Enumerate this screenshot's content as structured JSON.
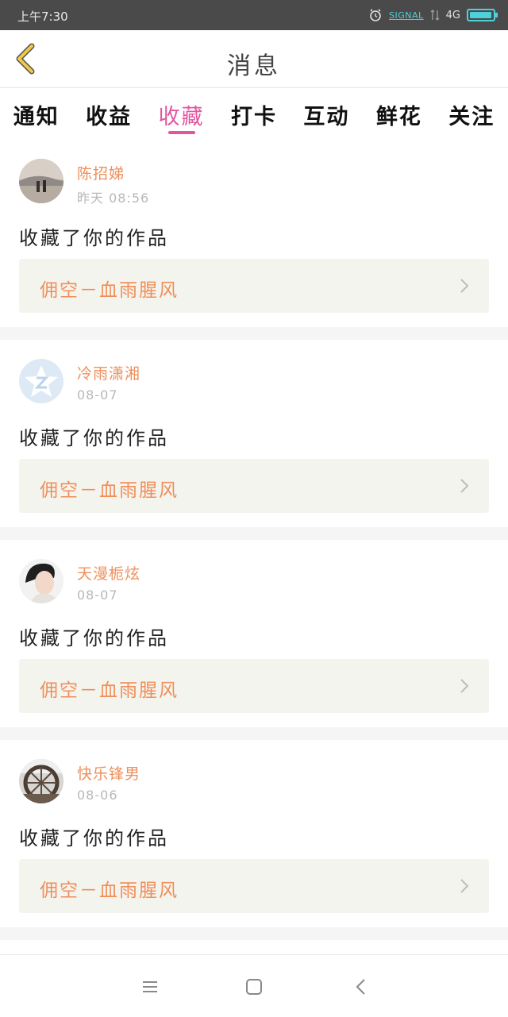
{
  "status_bar": {
    "time": "上午7:30",
    "signal_label": "SIGNAL",
    "network": "4G",
    "battery_level": 0.95,
    "icons": [
      "alarm-icon",
      "data-arrows-icon",
      "battery-icon"
    ]
  },
  "header": {
    "title": "消息",
    "back_icon": "chevron-left-icon",
    "accent_color": "#f0c94a"
  },
  "tabs": {
    "items": [
      {
        "label": "通知",
        "active": false
      },
      {
        "label": "收益",
        "active": false
      },
      {
        "label": "收藏",
        "active": true
      },
      {
        "label": "打卡",
        "active": false
      },
      {
        "label": "互动",
        "active": false
      },
      {
        "label": "鲜花",
        "active": false
      },
      {
        "label": "关注",
        "active": false
      }
    ],
    "active_color": "#e0579f"
  },
  "messages": [
    {
      "user": "陈招娣",
      "time": "昨天 08:56",
      "action": "收藏了你的作品",
      "work": "佣空－血雨腥风",
      "avatar": "landscape-photo"
    },
    {
      "user": "冷雨潇湘",
      "time": "08-07",
      "action": "收藏了你的作品",
      "work": "佣空－血雨腥风",
      "avatar": "default-qq-avatar"
    },
    {
      "user": "天漫栀炫",
      "time": "08-07",
      "action": "收藏了你的作品",
      "work": "佣空－血雨腥风",
      "avatar": "portrait-photo"
    },
    {
      "user": "快乐锋男",
      "time": "08-06",
      "action": "收藏了你的作品",
      "work": "佣空－血雨腥风",
      "avatar": "waterwheel-photo"
    }
  ],
  "colors": {
    "username": "#ef8f5b",
    "work_title": "#ef8f5b",
    "card_bg": "#f4f4ee",
    "timestamp": "#b8b8b8"
  },
  "navbar": {
    "icons": [
      "menu-icon",
      "home-square-icon",
      "back-arrow-icon"
    ]
  }
}
